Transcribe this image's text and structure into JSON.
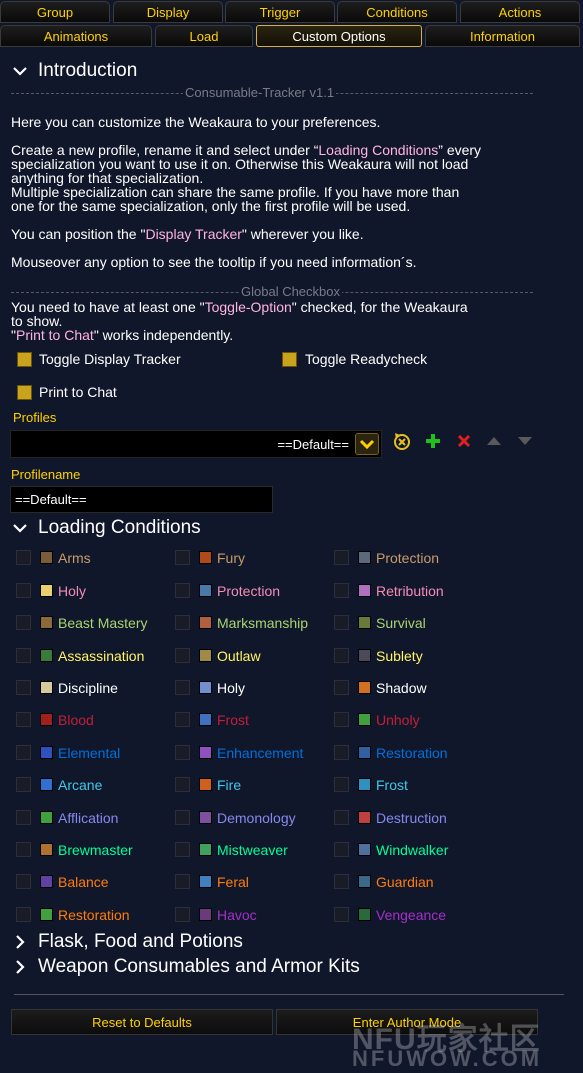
{
  "tabs_row1": [
    "Group",
    "Display",
    "Trigger",
    "Conditions",
    "Actions"
  ],
  "tabs_row2": [
    "Animations",
    "Load",
    "Custom Options",
    "Information"
  ],
  "introduction": {
    "title": "Introduction",
    "separator": "Consumable-Tracker v1.1",
    "p1": "Here you can customize the Weakaura to your preferences.",
    "p2a": "Create a new profile, rename it and select under “",
    "p2hl": "Loading Conditions",
    "p2b": "” every",
    "p2c": "specialization you want to use it on. Otherwise this Weakaura will not load",
    "p2d": "anything for that specialization.",
    "p2e": "Multiple specialization can share the same profile. If you have more than",
    "p2f": "one for the same specialization, only the first profile will be used.",
    "p3a": "You can position the  \"",
    "p3hl": "Display Tracker",
    "p3b": "\" wherever you like.",
    "p4": "Mouseover any option to see the tooltip if you need information´s.",
    "global_separator": "Global Checkbox",
    "p5a": "You need to have at least one \"",
    "p5hl": "Toggle-Option",
    "p5b": "\" checked, for the Weakaura",
    "p5c": "to show.",
    "p6a": "\"",
    "p6hl": "Print to Chat",
    "p6b": "\" works independently.",
    "toggle_display": "Toggle Display Tracker",
    "toggle_ready": "Toggle Readycheck",
    "print_chat": "Print to Chat",
    "profiles_label": "Profiles",
    "profiles_value": "==Default==",
    "profilename_label": "Profilename",
    "profilename_value": "==Default=="
  },
  "loading": {
    "title": "Loading Conditions",
    "specs": [
      {
        "label": "Arms",
        "color": "#c69b6d",
        "icon": "#7a5b3a"
      },
      {
        "label": "Fury",
        "color": "#c69b6d",
        "icon": "#b04a1a"
      },
      {
        "label": "Protection",
        "color": "#c69b6d",
        "icon": "#5a6a7a"
      },
      {
        "label": "Holy",
        "color": "#f48cba",
        "icon": "#e8d070"
      },
      {
        "label": "Protection",
        "color": "#f48cba",
        "icon": "#4a78a8"
      },
      {
        "label": "Retribution",
        "color": "#f48cba",
        "icon": "#b070c0"
      },
      {
        "label": "Beast Mastery",
        "color": "#aad372",
        "icon": "#8a6a3a"
      },
      {
        "label": "Marksmanship",
        "color": "#aad372",
        "icon": "#b06040"
      },
      {
        "label": "Survival",
        "color": "#aad372",
        "icon": "#6a7a3a"
      },
      {
        "label": "Assassination",
        "color": "#fff468",
        "icon": "#3a7a3a"
      },
      {
        "label": "Outlaw",
        "color": "#fff468",
        "icon": "#a08a4a"
      },
      {
        "label": "Sublety",
        "color": "#fff468",
        "icon": "#4a4a5a"
      },
      {
        "label": "Discipline",
        "color": "#ffffff",
        "icon": "#d8c8a0"
      },
      {
        "label": "Holy",
        "color": "#ffffff",
        "icon": "#7090d0"
      },
      {
        "label": "Shadow",
        "color": "#ffffff",
        "icon": "#d07020"
      },
      {
        "label": "Blood",
        "color": "#c41e3a",
        "icon": "#a02020"
      },
      {
        "label": "Frost",
        "color": "#c41e3a",
        "icon": "#4070c0"
      },
      {
        "label": "Unholy",
        "color": "#c41e3a",
        "icon": "#40a040"
      },
      {
        "label": "Elemental",
        "color": "#0070dd",
        "icon": "#3050c0"
      },
      {
        "label": "Enhancement",
        "color": "#0070dd",
        "icon": "#9050c0"
      },
      {
        "label": "Restoration",
        "color": "#0070dd",
        "icon": "#3060a0"
      },
      {
        "label": "Arcane",
        "color": "#3fc7eb",
        "icon": "#3070d0"
      },
      {
        "label": "Fire",
        "color": "#3fc7eb",
        "icon": "#d06020"
      },
      {
        "label": "Frost",
        "color": "#3fc7eb",
        "icon": "#3090c0"
      },
      {
        "label": "Afflication",
        "color": "#8788ee",
        "icon": "#40a040"
      },
      {
        "label": "Demonology",
        "color": "#8788ee",
        "icon": "#8050a0"
      },
      {
        "label": "Destruction",
        "color": "#8788ee",
        "icon": "#c04040"
      },
      {
        "label": "Brewmaster",
        "color": "#00ff98",
        "icon": "#b07030"
      },
      {
        "label": "Mistweaver",
        "color": "#00ff98",
        "icon": "#40a060"
      },
      {
        "label": "Windwalker",
        "color": "#00ff98",
        "icon": "#5070a0"
      },
      {
        "label": "Balance",
        "color": "#ff7c0a",
        "icon": "#6040a0"
      },
      {
        "label": "Feral",
        "color": "#ff7c0a",
        "icon": "#4080c0"
      },
      {
        "label": "Guardian",
        "color": "#ff7c0a",
        "icon": "#3a6a8a"
      },
      {
        "label": "Restoration",
        "color": "#ff7c0a",
        "icon": "#40a040"
      },
      {
        "label": "Havoc",
        "color": "#a330c9",
        "icon": "#6a3a7a"
      },
      {
        "label": "Vengeance",
        "color": "#a330c9",
        "icon": "#2a6a3a"
      }
    ]
  },
  "flask": {
    "title": "Flask, Food and Potions"
  },
  "weapon": {
    "title": "Weapon Consumables and Armor Kits"
  },
  "buttons": {
    "reset": "Reset to Defaults",
    "author": "Enter Author Mode"
  },
  "watermark": {
    "line1": "NFU玩家社区",
    "line2": "NFUWOW.COM"
  },
  "colors": {
    "gold": "#ffd100",
    "highlight": "#ffb3e6",
    "checkbox_on": "#c9a21e"
  }
}
